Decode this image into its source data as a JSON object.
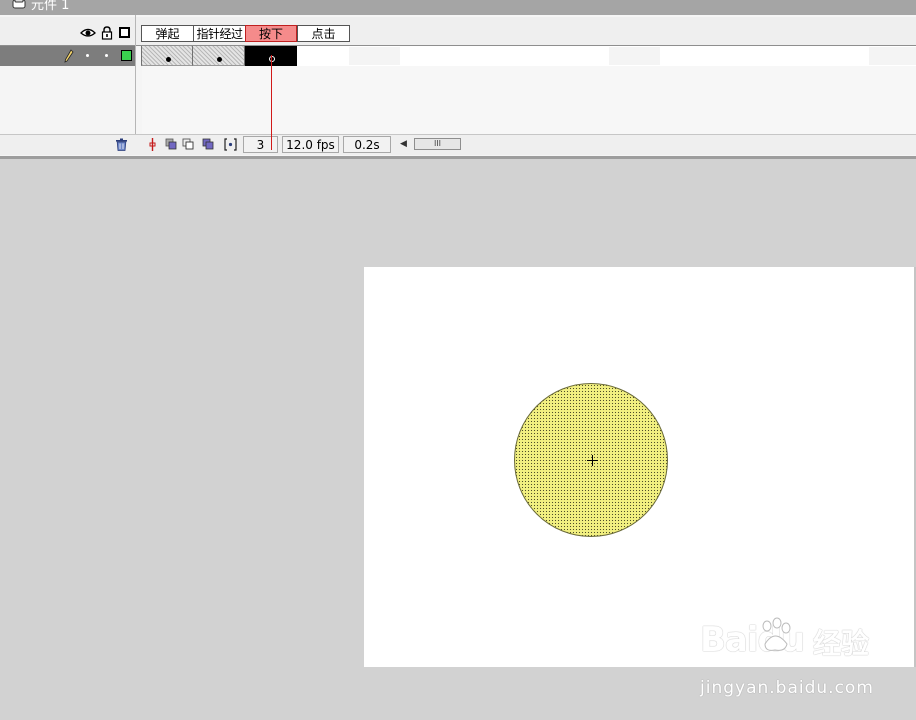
{
  "window": {
    "title": "元件 1",
    "icon": "button-symbol-icon"
  },
  "timeline": {
    "header_icons": [
      "eye-icon",
      "lock-icon",
      "outline-icon"
    ],
    "states": [
      {
        "label": "弹起",
        "active": false
      },
      {
        "label": "指针经过",
        "active": false
      },
      {
        "label": "按下",
        "active": true
      },
      {
        "label": "点击",
        "active": false
      }
    ],
    "layer": {
      "icons": [
        "pencil-icon"
      ],
      "color": "#3ad14f",
      "selected": true
    },
    "playhead_color": "#d11a1a",
    "status": {
      "current_frame": "3",
      "fps": "12.0 fps",
      "elapsed_time": "0.2s"
    }
  },
  "stage": {
    "background": "#ffffff",
    "shape": {
      "type": "circle",
      "fill": "#f2f081",
      "selected": true
    }
  },
  "watermark": {
    "logo": "Baidu",
    "product": "经验",
    "url": "jingyan.baidu.com"
  }
}
